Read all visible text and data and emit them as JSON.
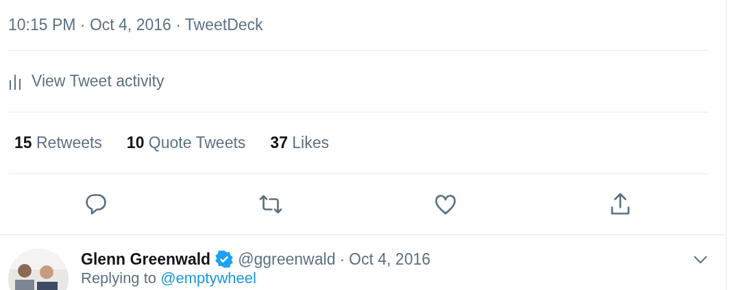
{
  "tweet": {
    "timestamp": "10:15 PM · Oct 4, 2016 · TweetDeck",
    "activity_link": "View Tweet activity",
    "stats": [
      {
        "count": "15",
        "label": "Retweets"
      },
      {
        "count": "10",
        "label": "Quote Tweets"
      },
      {
        "count": "37",
        "label": "Likes"
      }
    ],
    "actions": [
      {
        "kind": "reply"
      },
      {
        "kind": "retweet"
      },
      {
        "kind": "like"
      },
      {
        "kind": "share"
      }
    ]
  },
  "reply": {
    "name": "Glenn Greenwald",
    "verified": true,
    "handle": "@ggreenwald",
    "separator": "·",
    "date": "Oct 4, 2016",
    "replying_to": "Replying to",
    "mention": "@emptywheel"
  }
}
